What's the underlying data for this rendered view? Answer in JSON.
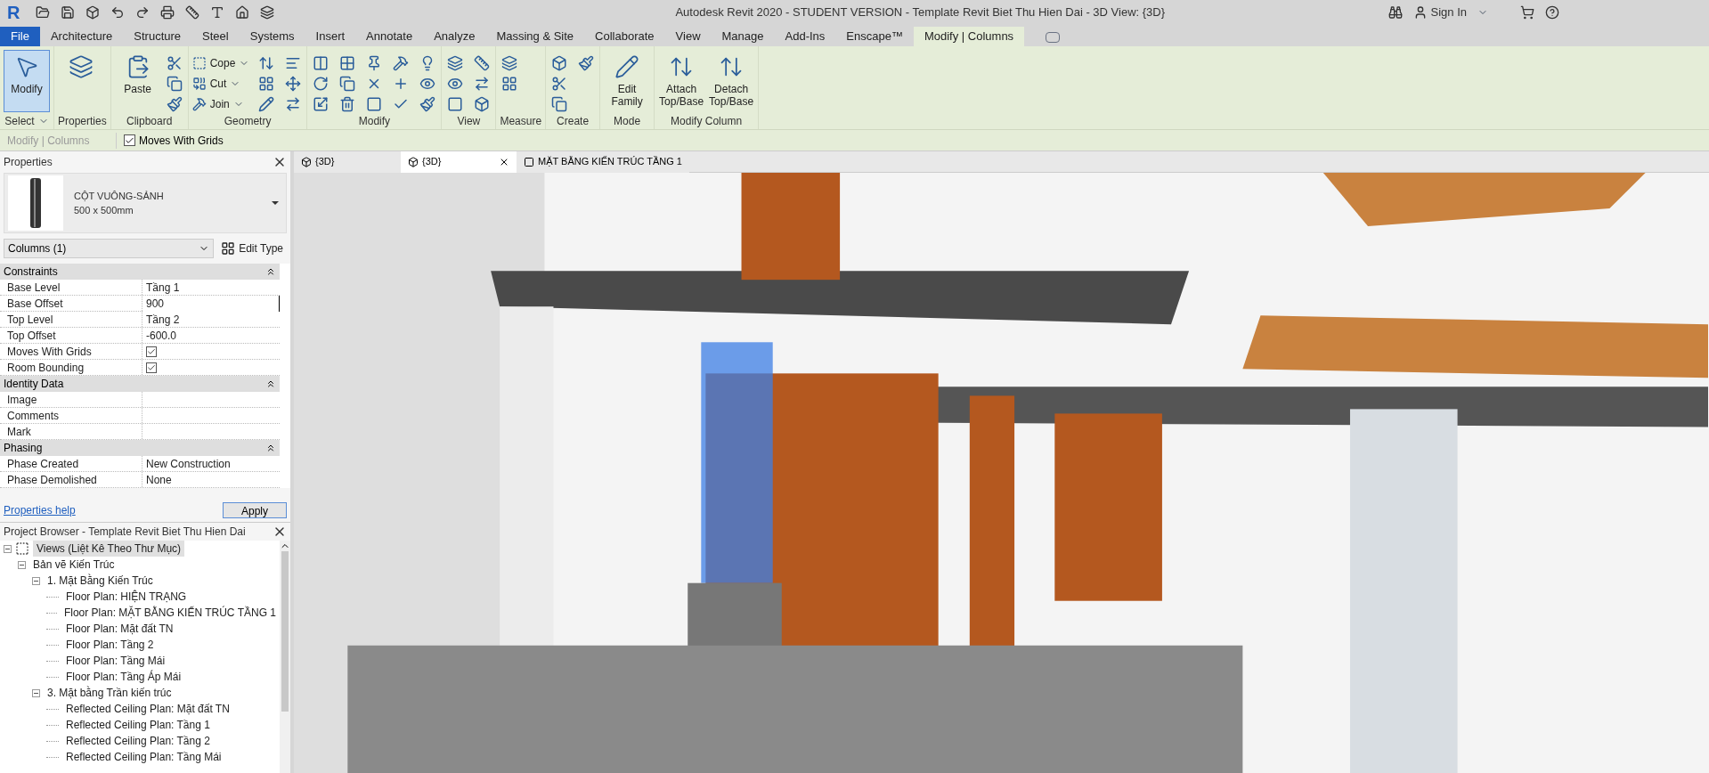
{
  "title_bar": {
    "app_logo": "R",
    "title": "Autodesk Revit 2020 - STUDENT VERSION - Template Revit Biet Thu Hien Dai - 3D View: {3D}",
    "sign_in": "Sign In"
  },
  "ribbon_tabs": [
    {
      "label": "File",
      "kind": "file",
      "selected": false
    },
    {
      "label": "Architecture",
      "kind": "tab",
      "selected": false
    },
    {
      "label": "Structure",
      "kind": "tab",
      "selected": false
    },
    {
      "label": "Steel",
      "kind": "tab",
      "selected": false
    },
    {
      "label": "Systems",
      "kind": "tab",
      "selected": false
    },
    {
      "label": "Insert",
      "kind": "tab",
      "selected": false
    },
    {
      "label": "Annotate",
      "kind": "tab",
      "selected": false
    },
    {
      "label": "Analyze",
      "kind": "tab",
      "selected": false
    },
    {
      "label": "Massing & Site",
      "kind": "tab",
      "selected": false
    },
    {
      "label": "Collaborate",
      "kind": "tab",
      "selected": false
    },
    {
      "label": "View",
      "kind": "tab",
      "selected": false
    },
    {
      "label": "Manage",
      "kind": "tab",
      "selected": false
    },
    {
      "label": "Add-Ins",
      "kind": "tab",
      "selected": false
    },
    {
      "label": "Enscape™",
      "kind": "tab",
      "selected": false
    },
    {
      "label": "Modify | Columns",
      "kind": "tab",
      "selected": true
    }
  ],
  "ribbon_panels": [
    {
      "label": "Select",
      "dropdown": true,
      "tools": [
        {
          "kind": "large",
          "label": "Modify",
          "selected": true
        }
      ]
    },
    {
      "label": "Properties",
      "dropdown": false,
      "tools": [
        {
          "kind": "large",
          "selected": false
        }
      ]
    },
    {
      "label": "Clipboard",
      "dropdown": false,
      "tools": [
        {
          "kind": "large",
          "label": "Paste",
          "selected": false
        },
        {
          "kind": "icon"
        },
        {
          "kind": "icon"
        },
        {
          "kind": "icon"
        }
      ]
    },
    {
      "label": "Geometry",
      "dropdown": false,
      "tools": [
        {
          "kind": "small",
          "label": "Cope"
        },
        {
          "kind": "small",
          "label": "Cut"
        },
        {
          "kind": "small",
          "label": "Join"
        },
        {
          "kind": "icon"
        },
        {
          "kind": "icon"
        },
        {
          "kind": "icon"
        },
        {
          "kind": "icon"
        },
        {
          "kind": "icon"
        },
        {
          "kind": "icon"
        }
      ]
    },
    {
      "label": "Modify",
      "dropdown": false,
      "tools": [
        {
          "kind": "icon"
        },
        {
          "kind": "icon"
        },
        {
          "kind": "icon"
        },
        {
          "kind": "icon"
        },
        {
          "kind": "icon"
        },
        {
          "kind": "icon"
        },
        {
          "kind": "icon"
        },
        {
          "kind": "icon"
        },
        {
          "kind": "icon"
        },
        {
          "kind": "icon"
        },
        {
          "kind": "icon"
        },
        {
          "kind": "icon"
        },
        {
          "kind": "icon"
        },
        {
          "kind": "icon"
        },
        {
          "kind": "icon"
        }
      ]
    },
    {
      "label": "View",
      "dropdown": false,
      "tools": [
        {
          "kind": "icon"
        },
        {
          "kind": "icon"
        },
        {
          "kind": "icon"
        },
        {
          "kind": "icon"
        },
        {
          "kind": "icon"
        },
        {
          "kind": "icon"
        }
      ]
    },
    {
      "label": "Measure",
      "dropdown": false,
      "tools": [
        {
          "kind": "icon"
        },
        {
          "kind": "icon"
        }
      ]
    },
    {
      "label": "Create",
      "dropdown": false,
      "tools": [
        {
          "kind": "icon"
        },
        {
          "kind": "icon"
        },
        {
          "kind": "icon"
        },
        {
          "kind": "icon"
        }
      ]
    },
    {
      "label": "Mode",
      "dropdown": false,
      "tools": [
        {
          "kind": "large",
          "label": "Edit Family",
          "selected": false
        }
      ]
    },
    {
      "label": "Modify Column",
      "dropdown": false,
      "tools": [
        {
          "kind": "large",
          "label": "Attach Top/Base",
          "selected": false
        },
        {
          "kind": "large",
          "label": "Detach Top/Base",
          "selected": false
        }
      ]
    }
  ],
  "options_bar": {
    "context": "Modify | Columns",
    "option": {
      "label": "Moves With Grids",
      "checked": true
    }
  },
  "properties": {
    "title": "Properties",
    "type_name": "CỘT VUÔNG-SẢNH",
    "type_size": "500 x 500mm",
    "selector": "Columns (1)",
    "edit_type": "Edit Type",
    "groups": [
      {
        "title": "Constraints",
        "expanded": true,
        "rows": [
          {
            "label": "Base Level",
            "kind": "text",
            "value": "Tầng 1"
          },
          {
            "label": "Base Offset",
            "kind": "input",
            "value": "900"
          },
          {
            "label": "Top Level",
            "kind": "text",
            "value": "Tầng 2"
          },
          {
            "label": "Top Offset",
            "kind": "text",
            "value": "-600.0"
          },
          {
            "label": "Moves With Grids",
            "kind": "check",
            "checked": true
          },
          {
            "label": "Room Bounding",
            "kind": "check",
            "checked": true
          }
        ]
      },
      {
        "title": "Identity Data",
        "expanded": true,
        "rows": [
          {
            "label": "Image",
            "kind": "text"
          },
          {
            "label": "Comments",
            "kind": "text"
          },
          {
            "label": "Mark",
            "kind": "text"
          }
        ]
      },
      {
        "title": "Phasing",
        "expanded": true,
        "rows": [
          {
            "label": "Phase Created",
            "kind": "text",
            "value": "New Construction"
          },
          {
            "label": "Phase Demolished",
            "kind": "text",
            "value": "None"
          }
        ]
      }
    ],
    "help_link": "Properties help",
    "apply": "Apply"
  },
  "project_browser": {
    "title": "Project Browser - Template Revit Biet Thu Hien Dai",
    "tree": [
      {
        "label": "Views (Liệt Kê Theo Thư Mục)",
        "expanded": true,
        "selected": true,
        "children": [
          {
            "label": "Bản vẽ Kiến Trúc",
            "expanded": true,
            "selected": false,
            "children": [
              {
                "label": "1. Mặt Bằng Kiến Trúc",
                "expanded": true,
                "selected": false,
                "children": [
                  {
                    "label": "Floor Plan: HIỆN TRẠNG",
                    "expanded": false,
                    "selected": false
                  },
                  {
                    "label": "Floor Plan: MẶT BẰNG KIẾN TRÚC TẦNG 1",
                    "expanded": false,
                    "selected": false
                  },
                  {
                    "label": "Floor Plan: Mặt đất TN",
                    "expanded": false,
                    "selected": false
                  },
                  {
                    "label": "Floor Plan: Tầng 2",
                    "expanded": false,
                    "selected": false
                  },
                  {
                    "label": "Floor Plan: Tầng Mái",
                    "expanded": false,
                    "selected": false
                  },
                  {
                    "label": "Floor Plan: Tầng Áp Mái",
                    "expanded": false,
                    "selected": false
                  }
                ]
              },
              {
                "label": "3. Mặt bằng Trần kiến trúc",
                "expanded": true,
                "selected": false,
                "children": [
                  {
                    "label": "Reflected Ceiling Plan: Mặt đất TN",
                    "expanded": false,
                    "selected": false
                  },
                  {
                    "label": "Reflected Ceiling Plan: Tầng 1",
                    "expanded": false,
                    "selected": false
                  },
                  {
                    "label": "Reflected Ceiling Plan: Tầng 2",
                    "expanded": false,
                    "selected": false
                  },
                  {
                    "label": "Reflected Ceiling Plan: Tầng Mái",
                    "expanded": false,
                    "selected": false
                  }
                ]
              }
            ]
          }
        ]
      }
    ]
  },
  "view_tabs": [
    {
      "label": "{3D}",
      "kind": "model",
      "selected": false
    },
    {
      "label": "{3D}",
      "kind": "model",
      "selected": true
    },
    {
      "label": "MẶT BẰNG KIẾN TRÚC TẦNG 1",
      "kind": "plan",
      "selected": false
    }
  ]
}
